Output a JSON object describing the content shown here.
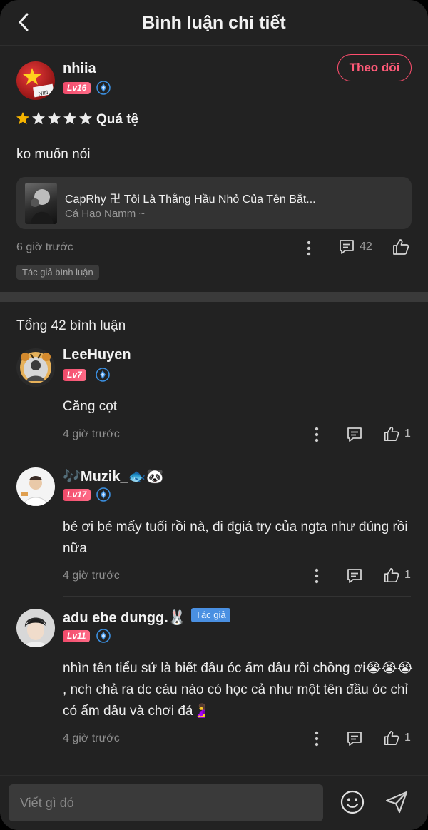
{
  "header": {
    "title": "Bình luận chi tiết"
  },
  "review": {
    "username": "nhiia",
    "level": "Lv16",
    "follow_label": "Theo dõi",
    "rating": 1,
    "rating_label": "Quá tệ",
    "text": "ko muốn nói",
    "book": {
      "title": "CapRhy 卍 Tôi Là Thằng Hầu Nhỏ Của Tên Bắt...",
      "author": "Cá Hạo Namm ~"
    },
    "time": "6 giờ trước",
    "reply_count": "42",
    "badge": "Tác giả bình luận"
  },
  "total_comments": "Tổng 42 bình luận",
  "comments": [
    {
      "username": "LeeHuyen",
      "level": "Lv7",
      "text": "Căng cọt",
      "time": "4 giờ trước",
      "likes": "1"
    },
    {
      "username": "🎶Muzik_🐟🐼",
      "level": "Lv17",
      "text": "bé ơi bé mấy tuổi rồi nà, đi đgiá try của ngta như đúng rồi nữa",
      "time": "4 giờ trước",
      "likes": "1"
    },
    {
      "username": "adu ebe dungg.🐰",
      "level": "Lv11",
      "tag": "Tác giả",
      "text": "nhìn tên tiểu sử là biết đầu óc ấm dâu rồi chồng ơi😭😭😭 , nch chả ra dc cáu nào có học cả như một tên đầu óc chỉ có ấm dâu và chơi đá🤰",
      "time": "4 giờ trước",
      "likes": "1"
    }
  ],
  "composer": {
    "placeholder": "Viết gì đó"
  },
  "colors": {
    "accent": "#ff4e6e",
    "star": "#f6b400",
    "level": "#f04a6a",
    "verify": "#3b8fe0",
    "author_tag": "#4a90e2"
  }
}
